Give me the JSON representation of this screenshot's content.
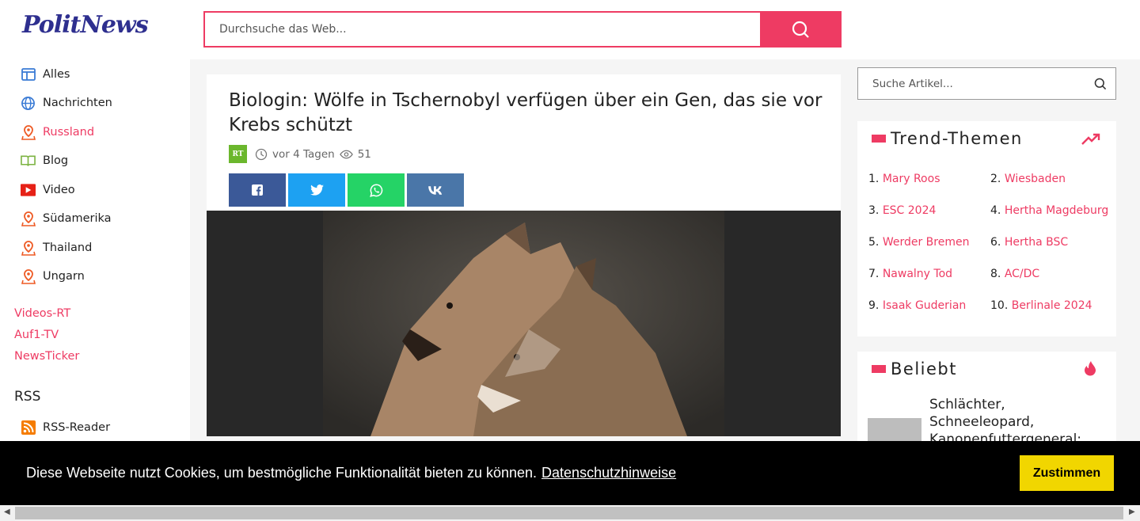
{
  "header": {
    "logo": "PolitNews",
    "search_placeholder": "Durchsuche das Web...",
    "search_button_icon": "search-icon"
  },
  "sidebar": {
    "items": [
      {
        "label": "Alles",
        "icon": "grid-icon"
      },
      {
        "label": "Nachrichten",
        "icon": "globe-icon"
      },
      {
        "label": "Russland",
        "icon": "map-pin-icon",
        "active": true
      },
      {
        "label": "Blog",
        "icon": "book-icon"
      },
      {
        "label": "Video",
        "icon": "play-icon"
      },
      {
        "label": "Südamerika",
        "icon": "map-pin-icon"
      },
      {
        "label": "Thailand",
        "icon": "map-pin-icon"
      },
      {
        "label": "Ungarn",
        "icon": "map-pin-icon"
      }
    ],
    "links": [
      "Videos-RT",
      "Auf1-TV",
      "NewsTicker"
    ],
    "rss_heading": "RSS",
    "rss_reader": "RSS-Reader"
  },
  "article": {
    "title": "Biologin: Wölfe in Tschernobyl verfügen über ein Gen, das sie vor Krebs schützt",
    "source_badge": "RT",
    "time": "vor 4 Tagen",
    "views": "51",
    "share_buttons": [
      {
        "network": "facebook",
        "color": "#3b5998"
      },
      {
        "network": "twitter",
        "color": "#1da1f2"
      },
      {
        "network": "whatsapp",
        "color": "#25d366"
      },
      {
        "network": "vk",
        "color": "#4a76a8"
      }
    ]
  },
  "right": {
    "search_placeholder": "Suche Artikel...",
    "trends": {
      "title": "Trend-Themen",
      "items": [
        {
          "num": "1.",
          "label": "Mary Roos"
        },
        {
          "num": "2.",
          "label": "Wiesbaden"
        },
        {
          "num": "3.",
          "label": "ESC 2024"
        },
        {
          "num": "4.",
          "label": "Hertha Magdeburg"
        },
        {
          "num": "5.",
          "label": "Werder Bremen"
        },
        {
          "num": "6.",
          "label": "Hertha BSC"
        },
        {
          "num": "7.",
          "label": "Nawalny Tod"
        },
        {
          "num": "8.",
          "label": "AC/DC"
        },
        {
          "num": "9.",
          "label": "Isaak Guderian"
        },
        {
          "num": "10.",
          "label": "Berlinale 2024"
        }
      ]
    },
    "popular": {
      "title": "Beliebt",
      "first_title": "Schlächter, Schneeleopard, Kanonenfuttergeneral:"
    }
  },
  "cookie": {
    "message": "Diese Webseite nutzt Cookies, um bestmögliche Funktionalität bieten zu können.",
    "link": "Datenschutzhinweise",
    "button": "Zustimmen"
  },
  "colors": {
    "accent": "#ee3b63",
    "logo": "#2e2f8f",
    "cookie_button": "#f1d600"
  }
}
